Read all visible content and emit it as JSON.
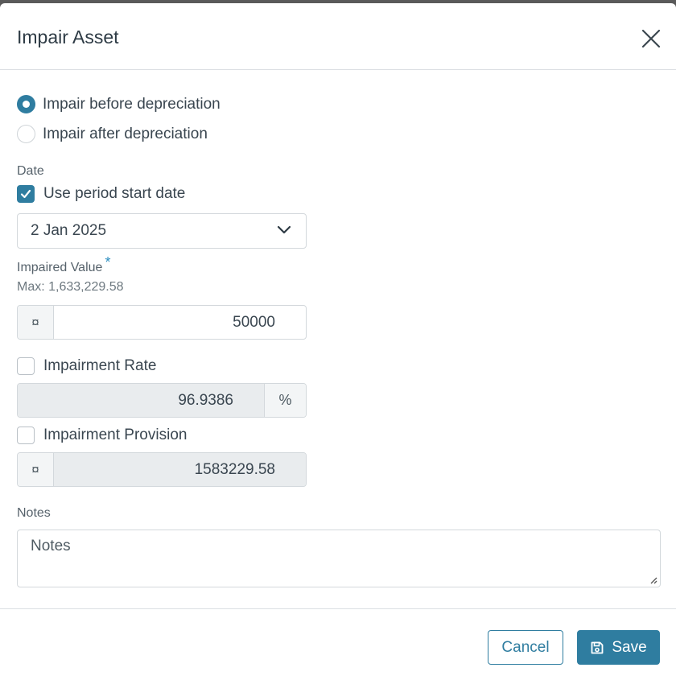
{
  "modal": {
    "title": "Impair Asset",
    "close_icon": "close-icon"
  },
  "impair_mode": {
    "options": [
      {
        "label": "Impair before depreciation",
        "selected": true
      },
      {
        "label": "Impair after depreciation",
        "selected": false
      }
    ]
  },
  "date": {
    "label": "Date",
    "use_period_start_label": "Use period start date",
    "use_period_start_checked": true,
    "selected_value": "2 Jan 2025",
    "chevron_icon": "chevron-down-icon"
  },
  "impaired_value": {
    "label": "Impaired Value",
    "required_mark": "*",
    "max_hint": "Max: 1,633,229.58",
    "currency_symbol": "¤",
    "value": "50000"
  },
  "impairment_rate": {
    "label": "Impairment Rate",
    "checked": false,
    "value": "96.9386",
    "suffix": "%"
  },
  "impairment_provision": {
    "label": "Impairment Provision",
    "checked": false,
    "currency_symbol": "¤",
    "value": "1583229.58"
  },
  "notes": {
    "label": "Notes",
    "placeholder": "Notes"
  },
  "footer": {
    "cancel_label": "Cancel",
    "save_label": "Save",
    "save_icon": "save-icon"
  },
  "colors": {
    "accent": "#2f7da0",
    "required": "#2f8fc0",
    "disabled_bg": "#e9ecee"
  }
}
